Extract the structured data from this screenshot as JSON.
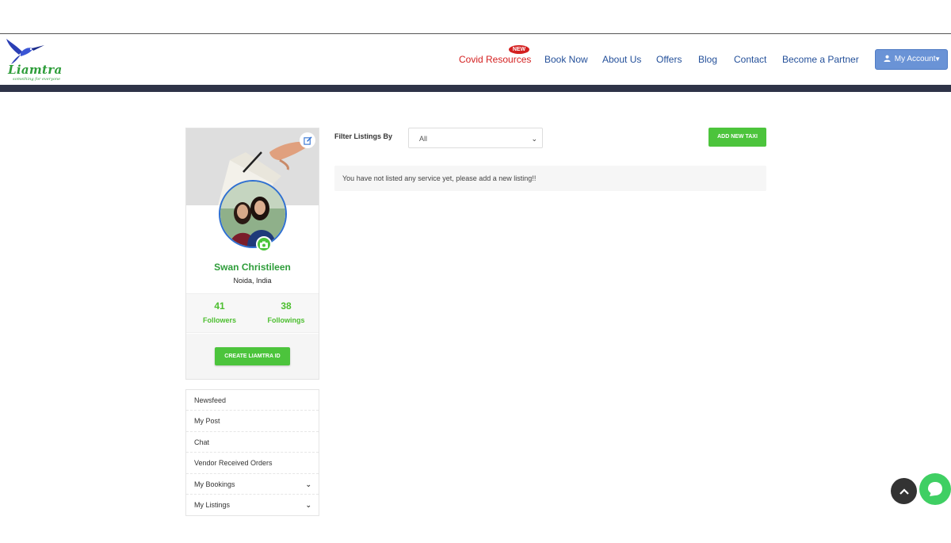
{
  "brand": {
    "name": "Liamtra",
    "tagline": "something for everyone",
    "logo_icon": "hummingbird-icon"
  },
  "nav": {
    "items": [
      {
        "label": "Covid Resources",
        "badge": "NEW"
      },
      {
        "label": "Book Now"
      },
      {
        "label": "About Us"
      },
      {
        "label": "Offers"
      },
      {
        "label": "Blog"
      },
      {
        "label": "Contact"
      },
      {
        "label": "Become a Partner"
      }
    ],
    "account_label": "My Account"
  },
  "profile": {
    "name": "Swan Christileen",
    "location": "Noida, India",
    "followers_count": "41",
    "followers_label": "Followers",
    "followings_count": "38",
    "followings_label": "Followings",
    "create_id_label": "CREATE LIAMTRA ID"
  },
  "sidebar_menu": {
    "items": [
      {
        "label": "Newsfeed",
        "expandable": false
      },
      {
        "label": "My Post",
        "expandable": false
      },
      {
        "label": "Chat",
        "expandable": false
      },
      {
        "label": "Vendor Received Orders",
        "expandable": false
      },
      {
        "label": "My Bookings",
        "expandable": true
      },
      {
        "label": "My Listings",
        "expandable": true
      }
    ]
  },
  "listings": {
    "filter_label": "Filter Listings By",
    "filter_value": "All",
    "add_button_label": "ADD NEW TAXI",
    "empty_message": "You have not listed any service yet, please add a new listing!!"
  },
  "colors": {
    "brand_green": "#4cc43c",
    "nav_blue": "#24509a",
    "covid_red": "#d42020",
    "header_bar": "#2f3448",
    "account_button": "#6a93d6"
  }
}
